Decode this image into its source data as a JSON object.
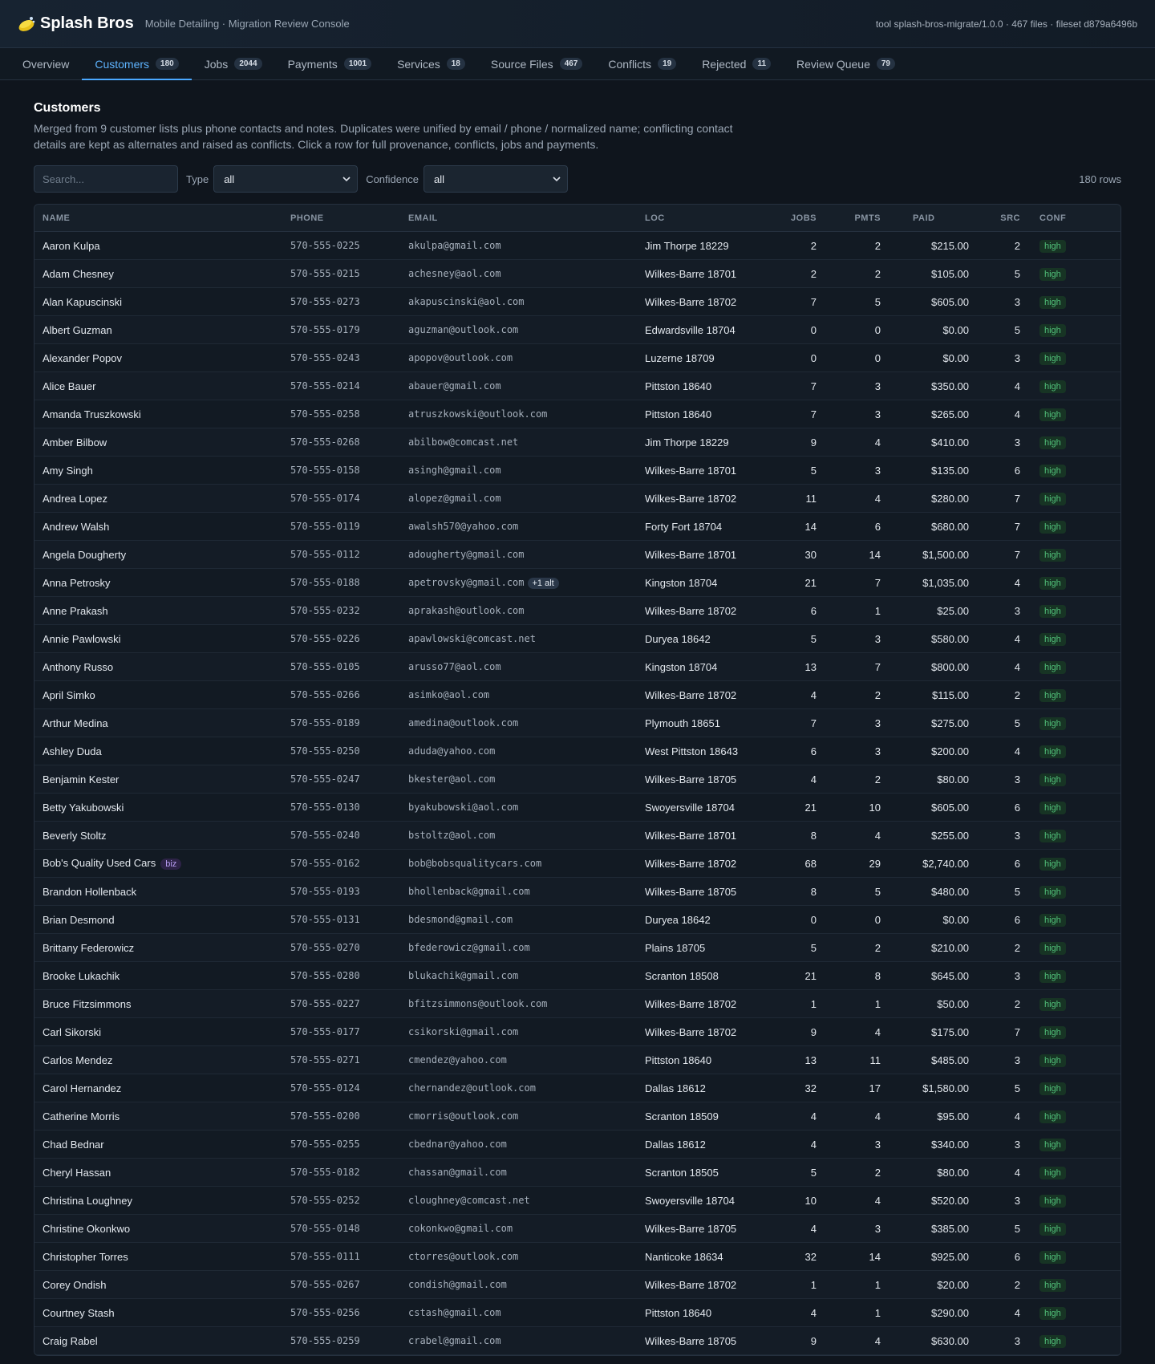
{
  "app": {
    "brand": "Splash Bros",
    "subtitle": "Mobile Detailing · Migration Review Console",
    "meta": "tool splash-bros-migrate/1.0.0 · 467 files · fileset d879a6496b",
    "logo_icon": "soap-bar-icon"
  },
  "tabs": [
    {
      "label": "Overview",
      "count": ""
    },
    {
      "label": "Customers",
      "count": "180"
    },
    {
      "label": "Jobs",
      "count": "2044"
    },
    {
      "label": "Payments",
      "count": "1001"
    },
    {
      "label": "Services",
      "count": "18"
    },
    {
      "label": "Source Files",
      "count": "467"
    },
    {
      "label": "Conflicts",
      "count": "19"
    },
    {
      "label": "Rejected",
      "count": "11"
    },
    {
      "label": "Review Queue",
      "count": "79"
    }
  ],
  "active_tab": "Customers",
  "page": {
    "title": "Customers",
    "description": "Merged from 9 customer lists plus phone contacts and notes. Duplicates were unified by email / phone / normalized name; conflicting contact details are kept as alternates and raised as conflicts. Click a row for full provenance, conflicts, jobs and payments."
  },
  "filters": {
    "search_placeholder": "Search...",
    "type_label": "Type",
    "type_value": "all",
    "confidence_label": "Confidence",
    "confidence_value": "all",
    "row_count": "180 rows"
  },
  "table": {
    "headers": [
      "NAME",
      "PHONE",
      "EMAIL",
      "LOC",
      "JOBS",
      "PMTS",
      "PAID",
      "SRC",
      "CONF"
    ],
    "rows": [
      {
        "name": "Aaron Kulpa",
        "tag": "",
        "phone": "570-555-0225",
        "email": "akulpa@gmail.com",
        "alt": "",
        "loc": "Jim Thorpe 18229",
        "jobs": "2",
        "pmts": "2",
        "paid": "$215.00",
        "src": "2",
        "conf": "high"
      },
      {
        "name": "Adam Chesney",
        "tag": "",
        "phone": "570-555-0215",
        "email": "achesney@aol.com",
        "alt": "",
        "loc": "Wilkes-Barre 18701",
        "jobs": "2",
        "pmts": "2",
        "paid": "$105.00",
        "src": "5",
        "conf": "high"
      },
      {
        "name": "Alan Kapuscinski",
        "tag": "",
        "phone": "570-555-0273",
        "email": "akapuscinski@aol.com",
        "alt": "",
        "loc": "Wilkes-Barre 18702",
        "jobs": "7",
        "pmts": "5",
        "paid": "$605.00",
        "src": "3",
        "conf": "high"
      },
      {
        "name": "Albert Guzman",
        "tag": "",
        "phone": "570-555-0179",
        "email": "aguzman@outlook.com",
        "alt": "",
        "loc": "Edwardsville 18704",
        "jobs": "0",
        "pmts": "0",
        "paid": "$0.00",
        "src": "5",
        "conf": "high"
      },
      {
        "name": "Alexander Popov",
        "tag": "",
        "phone": "570-555-0243",
        "email": "apopov@outlook.com",
        "alt": "",
        "loc": "Luzerne 18709",
        "jobs": "0",
        "pmts": "0",
        "paid": "$0.00",
        "src": "3",
        "conf": "high"
      },
      {
        "name": "Alice Bauer",
        "tag": "",
        "phone": "570-555-0214",
        "email": "abauer@gmail.com",
        "alt": "",
        "loc": "Pittston 18640",
        "jobs": "7",
        "pmts": "3",
        "paid": "$350.00",
        "src": "4",
        "conf": "high"
      },
      {
        "name": "Amanda Truszkowski",
        "tag": "",
        "phone": "570-555-0258",
        "email": "atruszkowski@outlook.com",
        "alt": "",
        "loc": "Pittston 18640",
        "jobs": "7",
        "pmts": "3",
        "paid": "$265.00",
        "src": "4",
        "conf": "high"
      },
      {
        "name": "Amber Bilbow",
        "tag": "",
        "phone": "570-555-0268",
        "email": "abilbow@comcast.net",
        "alt": "",
        "loc": "Jim Thorpe 18229",
        "jobs": "9",
        "pmts": "4",
        "paid": "$410.00",
        "src": "3",
        "conf": "high"
      },
      {
        "name": "Amy Singh",
        "tag": "",
        "phone": "570-555-0158",
        "email": "asingh@gmail.com",
        "alt": "",
        "loc": "Wilkes-Barre 18701",
        "jobs": "5",
        "pmts": "3",
        "paid": "$135.00",
        "src": "6",
        "conf": "high"
      },
      {
        "name": "Andrea Lopez",
        "tag": "",
        "phone": "570-555-0174",
        "email": "alopez@gmail.com",
        "alt": "",
        "loc": "Wilkes-Barre 18702",
        "jobs": "11",
        "pmts": "4",
        "paid": "$280.00",
        "src": "7",
        "conf": "high"
      },
      {
        "name": "Andrew Walsh",
        "tag": "",
        "phone": "570-555-0119",
        "email": "awalsh570@yahoo.com",
        "alt": "",
        "loc": "Forty Fort 18704",
        "jobs": "14",
        "pmts": "6",
        "paid": "$680.00",
        "src": "7",
        "conf": "high"
      },
      {
        "name": "Angela Dougherty",
        "tag": "",
        "phone": "570-555-0112",
        "email": "adougherty@gmail.com",
        "alt": "",
        "loc": "Wilkes-Barre 18701",
        "jobs": "30",
        "pmts": "14",
        "paid": "$1,500.00",
        "src": "7",
        "conf": "high"
      },
      {
        "name": "Anna Petrosky",
        "tag": "",
        "phone": "570-555-0188",
        "email": "apetrovsky@gmail.com",
        "alt": "+1 alt",
        "loc": "Kingston 18704",
        "jobs": "21",
        "pmts": "7",
        "paid": "$1,035.00",
        "src": "4",
        "conf": "high"
      },
      {
        "name": "Anne Prakash",
        "tag": "",
        "phone": "570-555-0232",
        "email": "aprakash@outlook.com",
        "alt": "",
        "loc": "Wilkes-Barre 18702",
        "jobs": "6",
        "pmts": "1",
        "paid": "$25.00",
        "src": "3",
        "conf": "high"
      },
      {
        "name": "Annie Pawlowski",
        "tag": "",
        "phone": "570-555-0226",
        "email": "apawlowski@comcast.net",
        "alt": "",
        "loc": "Duryea 18642",
        "jobs": "5",
        "pmts": "3",
        "paid": "$580.00",
        "src": "4",
        "conf": "high"
      },
      {
        "name": "Anthony Russo",
        "tag": "",
        "phone": "570-555-0105",
        "email": "arusso77@aol.com",
        "alt": "",
        "loc": "Kingston 18704",
        "jobs": "13",
        "pmts": "7",
        "paid": "$800.00",
        "src": "4",
        "conf": "high"
      },
      {
        "name": "April Simko",
        "tag": "",
        "phone": "570-555-0266",
        "email": "asimko@aol.com",
        "alt": "",
        "loc": "Wilkes-Barre 18702",
        "jobs": "4",
        "pmts": "2",
        "paid": "$115.00",
        "src": "2",
        "conf": "high"
      },
      {
        "name": "Arthur Medina",
        "tag": "",
        "phone": "570-555-0189",
        "email": "amedina@outlook.com",
        "alt": "",
        "loc": "Plymouth 18651",
        "jobs": "7",
        "pmts": "3",
        "paid": "$275.00",
        "src": "5",
        "conf": "high"
      },
      {
        "name": "Ashley Duda",
        "tag": "",
        "phone": "570-555-0250",
        "email": "aduda@yahoo.com",
        "alt": "",
        "loc": "West Pittston 18643",
        "jobs": "6",
        "pmts": "3",
        "paid": "$200.00",
        "src": "4",
        "conf": "high"
      },
      {
        "name": "Benjamin Kester",
        "tag": "",
        "phone": "570-555-0247",
        "email": "bkester@aol.com",
        "alt": "",
        "loc": "Wilkes-Barre 18705",
        "jobs": "4",
        "pmts": "2",
        "paid": "$80.00",
        "src": "3",
        "conf": "high"
      },
      {
        "name": "Betty Yakubowski",
        "tag": "",
        "phone": "570-555-0130",
        "email": "byakubowski@aol.com",
        "alt": "",
        "loc": "Swoyersville 18704",
        "jobs": "21",
        "pmts": "10",
        "paid": "$605.00",
        "src": "6",
        "conf": "high"
      },
      {
        "name": "Beverly Stoltz",
        "tag": "",
        "phone": "570-555-0240",
        "email": "bstoltz@aol.com",
        "alt": "",
        "loc": "Wilkes-Barre 18701",
        "jobs": "8",
        "pmts": "4",
        "paid": "$255.00",
        "src": "3",
        "conf": "high"
      },
      {
        "name": "Bob's Quality Used Cars",
        "tag": "biz",
        "phone": "570-555-0162",
        "email": "bob@bobsqualitycars.com",
        "alt": "",
        "loc": "Wilkes-Barre 18702",
        "jobs": "68",
        "pmts": "29",
        "paid": "$2,740.00",
        "src": "6",
        "conf": "high"
      },
      {
        "name": "Brandon Hollenback",
        "tag": "",
        "phone": "570-555-0193",
        "email": "bhollenback@gmail.com",
        "alt": "",
        "loc": "Wilkes-Barre 18705",
        "jobs": "8",
        "pmts": "5",
        "paid": "$480.00",
        "src": "5",
        "conf": "high"
      },
      {
        "name": "Brian Desmond",
        "tag": "",
        "phone": "570-555-0131",
        "email": "bdesmond@gmail.com",
        "alt": "",
        "loc": "Duryea 18642",
        "jobs": "0",
        "pmts": "0",
        "paid": "$0.00",
        "src": "6",
        "conf": "high"
      },
      {
        "name": "Brittany Federowicz",
        "tag": "",
        "phone": "570-555-0270",
        "email": "bfederowicz@gmail.com",
        "alt": "",
        "loc": "Plains 18705",
        "jobs": "5",
        "pmts": "2",
        "paid": "$210.00",
        "src": "2",
        "conf": "high"
      },
      {
        "name": "Brooke Lukachik",
        "tag": "",
        "phone": "570-555-0280",
        "email": "blukachik@gmail.com",
        "alt": "",
        "loc": "Scranton 18508",
        "jobs": "21",
        "pmts": "8",
        "paid": "$645.00",
        "src": "3",
        "conf": "high"
      },
      {
        "name": "Bruce Fitzsimmons",
        "tag": "",
        "phone": "570-555-0227",
        "email": "bfitzsimmons@outlook.com",
        "alt": "",
        "loc": "Wilkes-Barre 18702",
        "jobs": "1",
        "pmts": "1",
        "paid": "$50.00",
        "src": "2",
        "conf": "high"
      },
      {
        "name": "Carl Sikorski",
        "tag": "",
        "phone": "570-555-0177",
        "email": "csikorski@gmail.com",
        "alt": "",
        "loc": "Wilkes-Barre 18702",
        "jobs": "9",
        "pmts": "4",
        "paid": "$175.00",
        "src": "7",
        "conf": "high"
      },
      {
        "name": "Carlos Mendez",
        "tag": "",
        "phone": "570-555-0271",
        "email": "cmendez@yahoo.com",
        "alt": "",
        "loc": "Pittston 18640",
        "jobs": "13",
        "pmts": "11",
        "paid": "$485.00",
        "src": "3",
        "conf": "high"
      },
      {
        "name": "Carol Hernandez",
        "tag": "",
        "phone": "570-555-0124",
        "email": "chernandez@outlook.com",
        "alt": "",
        "loc": "Dallas 18612",
        "jobs": "32",
        "pmts": "17",
        "paid": "$1,580.00",
        "src": "5",
        "conf": "high"
      },
      {
        "name": "Catherine Morris",
        "tag": "",
        "phone": "570-555-0200",
        "email": "cmorris@outlook.com",
        "alt": "",
        "loc": "Scranton 18509",
        "jobs": "4",
        "pmts": "4",
        "paid": "$95.00",
        "src": "4",
        "conf": "high"
      },
      {
        "name": "Chad Bednar",
        "tag": "",
        "phone": "570-555-0255",
        "email": "cbednar@yahoo.com",
        "alt": "",
        "loc": "Dallas 18612",
        "jobs": "4",
        "pmts": "3",
        "paid": "$340.00",
        "src": "3",
        "conf": "high"
      },
      {
        "name": "Cheryl Hassan",
        "tag": "",
        "phone": "570-555-0182",
        "email": "chassan@gmail.com",
        "alt": "",
        "loc": "Scranton 18505",
        "jobs": "5",
        "pmts": "2",
        "paid": "$80.00",
        "src": "4",
        "conf": "high"
      },
      {
        "name": "Christina Loughney",
        "tag": "",
        "phone": "570-555-0252",
        "email": "cloughney@comcast.net",
        "alt": "",
        "loc": "Swoyersville 18704",
        "jobs": "10",
        "pmts": "4",
        "paid": "$520.00",
        "src": "3",
        "conf": "high"
      },
      {
        "name": "Christine Okonkwo",
        "tag": "",
        "phone": "570-555-0148",
        "email": "cokonkwo@gmail.com",
        "alt": "",
        "loc": "Wilkes-Barre 18705",
        "jobs": "4",
        "pmts": "3",
        "paid": "$385.00",
        "src": "5",
        "conf": "high"
      },
      {
        "name": "Christopher Torres",
        "tag": "",
        "phone": "570-555-0111",
        "email": "ctorres@outlook.com",
        "alt": "",
        "loc": "Nanticoke 18634",
        "jobs": "32",
        "pmts": "14",
        "paid": "$925.00",
        "src": "6",
        "conf": "high"
      },
      {
        "name": "Corey Ondish",
        "tag": "",
        "phone": "570-555-0267",
        "email": "condish@gmail.com",
        "alt": "",
        "loc": "Wilkes-Barre 18702",
        "jobs": "1",
        "pmts": "1",
        "paid": "$20.00",
        "src": "2",
        "conf": "high"
      },
      {
        "name": "Courtney Stash",
        "tag": "",
        "phone": "570-555-0256",
        "email": "cstash@gmail.com",
        "alt": "",
        "loc": "Pittston 18640",
        "jobs": "4",
        "pmts": "1",
        "paid": "$290.00",
        "src": "4",
        "conf": "high"
      },
      {
        "name": "Craig Rabel",
        "tag": "",
        "phone": "570-555-0259",
        "email": "crabel@gmail.com",
        "alt": "",
        "loc": "Wilkes-Barre 18705",
        "jobs": "9",
        "pmts": "4",
        "paid": "$630.00",
        "src": "3",
        "conf": "high"
      }
    ]
  }
}
